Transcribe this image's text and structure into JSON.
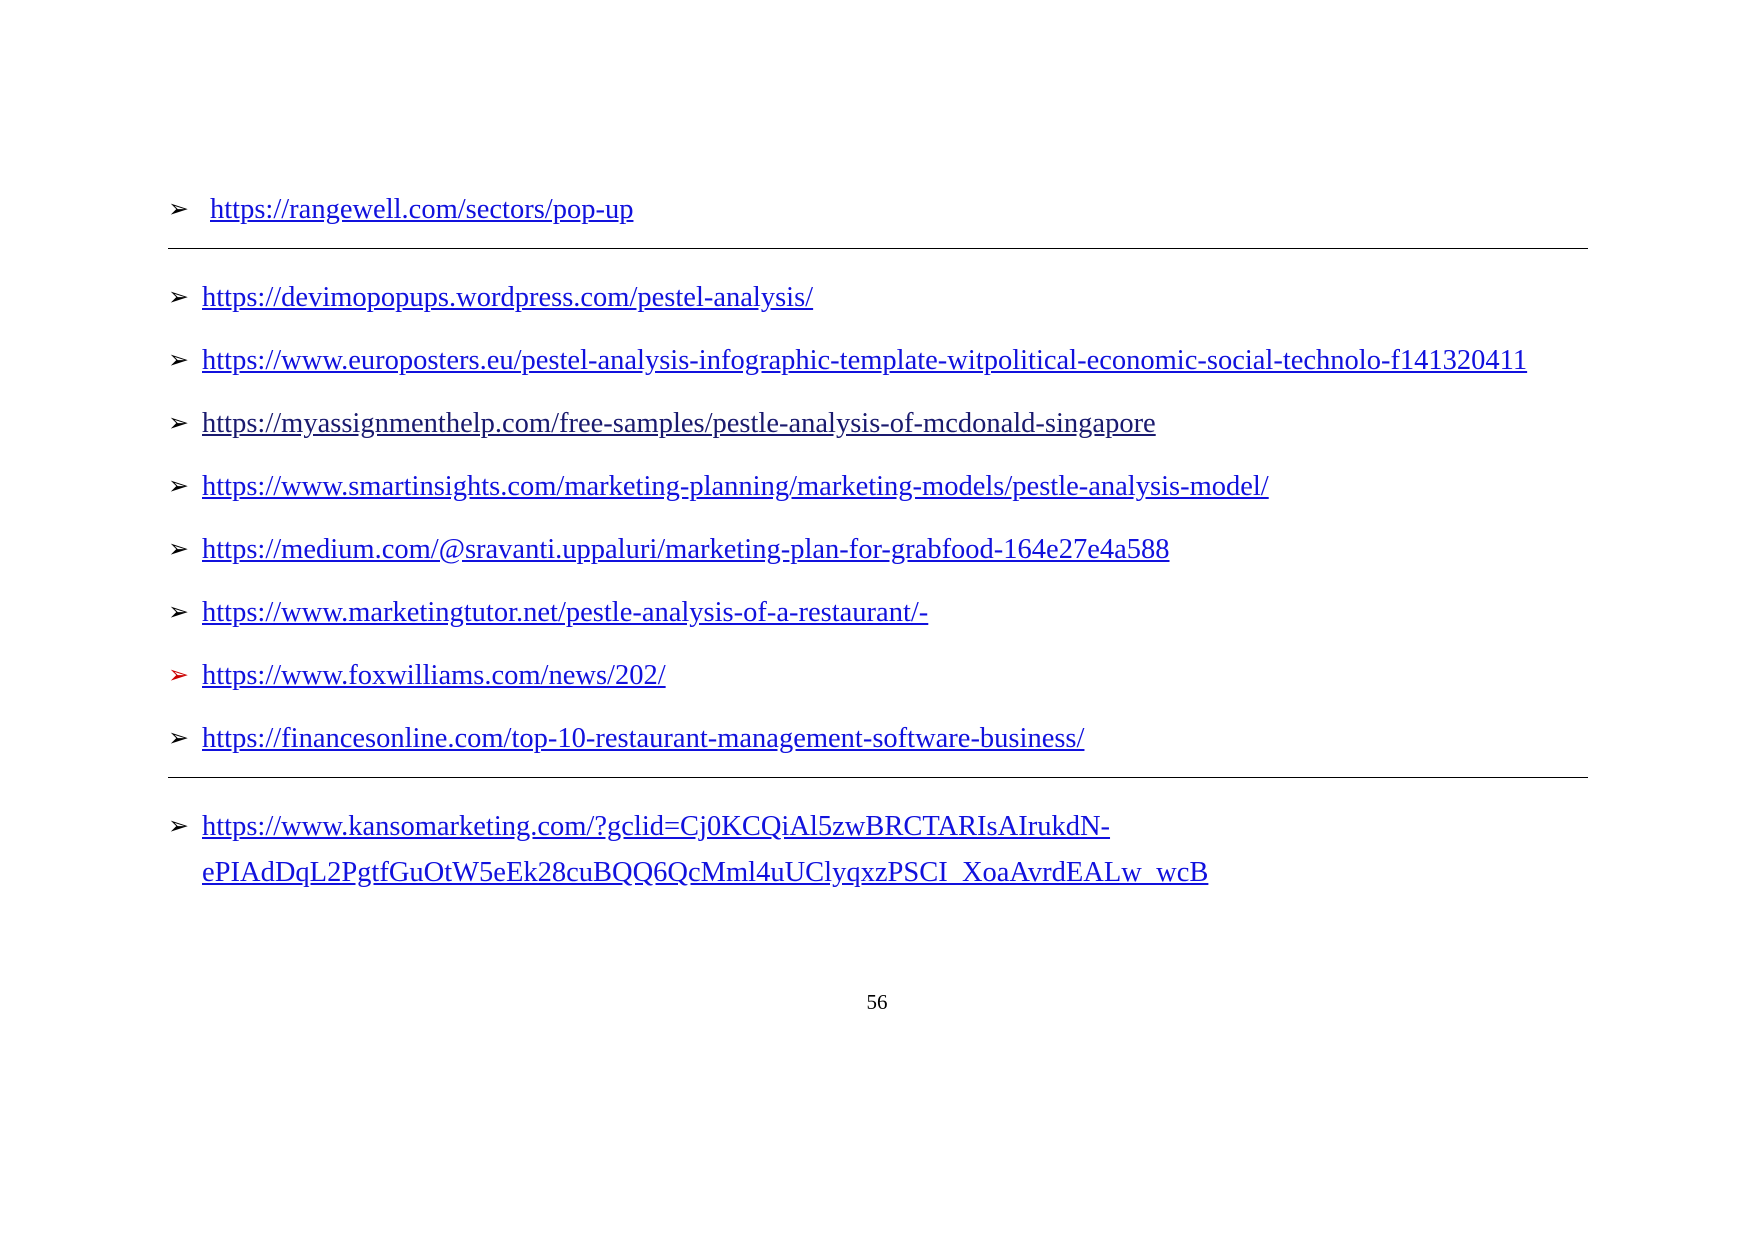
{
  "document": {
    "page_number": "56",
    "bullet_glyph": "➢",
    "link_color": "#1111dd",
    "alt_link_color": "#1a1a6e",
    "red_bullet_color": "#cc0000",
    "page_background": "#ffffff"
  },
  "links": [
    {
      "text": "https://rangewell.com/sectors/pop-up",
      "bullet_color": "black",
      "rule_below": true,
      "style": "blue"
    },
    {
      "text": "https://devimopopups.wordpress.com/pestel-analysis/",
      "bullet_color": "black",
      "rule_below": false,
      "style": "blue"
    },
    {
      "text": "https://www.europosters.eu/pestel-analysis-infographic-template-witpolitical-economic-social-technolo-f141320411",
      "bullet_color": "black",
      "rule_below": false,
      "style": "blue"
    },
    {
      "text": "https://myassignmenthelp.com/free-samples/pestle-analysis-of-mcdonald-singapore",
      "bullet_color": "black",
      "rule_below": false,
      "style": "navy"
    },
    {
      "text": "https://www.smartinsights.com/marketing-planning/marketing-models/pestle-analysis-model/",
      "bullet_color": "black",
      "rule_below": false,
      "style": "blue"
    },
    {
      "text": "https://medium.com/@sravanti.uppaluri/marketing-plan-for-grabfood-164e27e4a588",
      "bullet_color": "black",
      "rule_below": false,
      "style": "blue"
    },
    {
      "text": "https://www.marketingtutor.net/pestle-analysis-of-a-restaurant/-",
      "bullet_color": "black",
      "rule_below": false,
      "style": "blue"
    },
    {
      "text": "https://www.foxwilliams.com/news/202/",
      "bullet_color": "red",
      "rule_below": false,
      "style": "blue"
    },
    {
      "text": "https://financesonline.com/top-10-restaurant-management-software-business/",
      "bullet_color": "black",
      "rule_below": true,
      "style": "blue"
    },
    {
      "text": "https://www.kansomarketing.com/?gclid=Cj0KCQiAl5zwBRCTARIsAIrukdN-ePIAdDqL2PgtfGuOtW5eEk28cuBQQ6QcMml4uUClyqxzPSCI_XoaAvrdEALw_wcB",
      "text_line_1": "https://www.kansomarketing.com/?gclid=Cj0KCQiAl5zwBRCTARIsAIrukdN-",
      "text_line_2": "ePIAdDqL2PgtfGuOtW5eEk28cuBQQ6QcMml4uUClyqxzPSCI_XoaAvrdEALw_wcB",
      "bullet_color": "black",
      "rule_below": false,
      "style": "blue",
      "wrapped": true
    }
  ]
}
